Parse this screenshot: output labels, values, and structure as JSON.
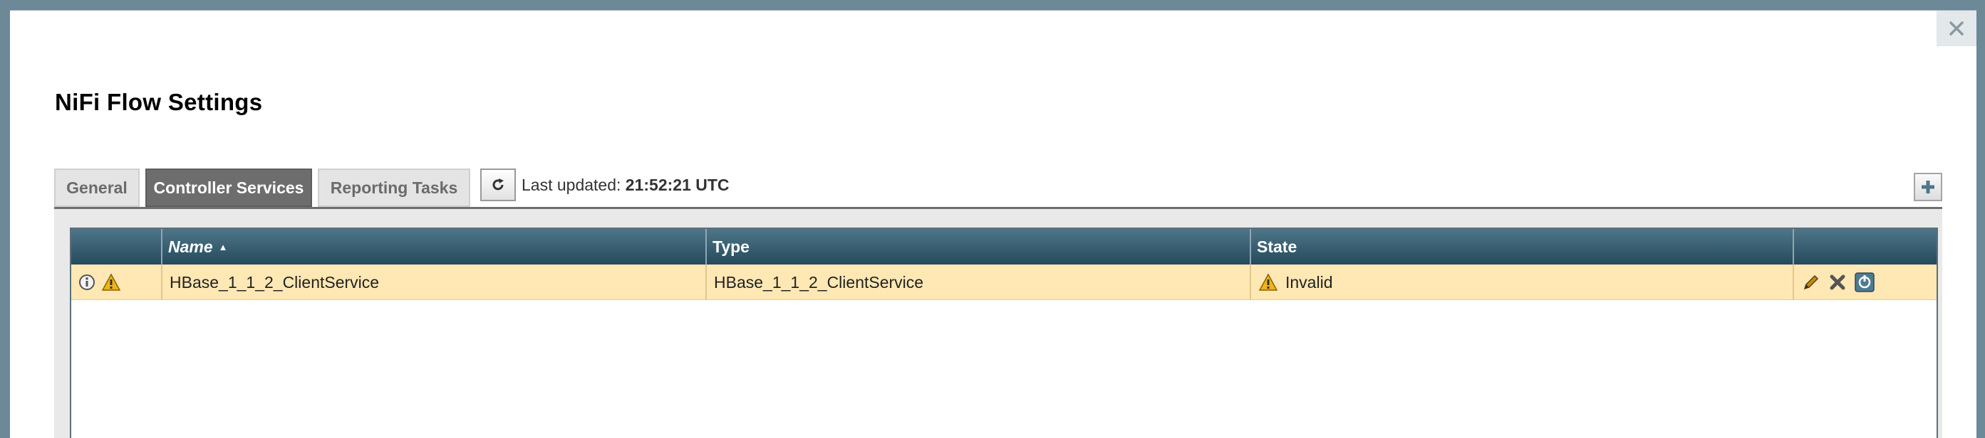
{
  "dialog": {
    "title": "NiFi Flow Settings"
  },
  "tabs": [
    {
      "label": "General",
      "active": false
    },
    {
      "label": "Controller Services",
      "active": true
    },
    {
      "label": "Reporting Tasks",
      "active": false
    }
  ],
  "status": {
    "last_updated_label": "Last updated:",
    "last_updated_value": "21:52:21 UTC"
  },
  "table": {
    "columns": [
      "",
      "Name",
      "Type",
      "State",
      ""
    ],
    "sorted_column": "Name",
    "rows": [
      {
        "name": "HBase_1_1_2_ClientService",
        "type": "HBase_1_1_2_ClientService",
        "state": "Invalid",
        "icons": [
          "info-icon",
          "warning-icon"
        ],
        "actions": [
          "edit-icon",
          "remove-icon",
          "enable-icon"
        ]
      }
    ]
  },
  "colors": {
    "header_dark": "#244a5c",
    "row_highlight": "#ffe8b3",
    "active_tab": "#6d6d6d",
    "warning": "#e8a317"
  },
  "icons": {
    "close": "close-icon",
    "refresh": "refresh-icon",
    "add": "plus-icon",
    "sort": "sort-ascending-icon"
  }
}
